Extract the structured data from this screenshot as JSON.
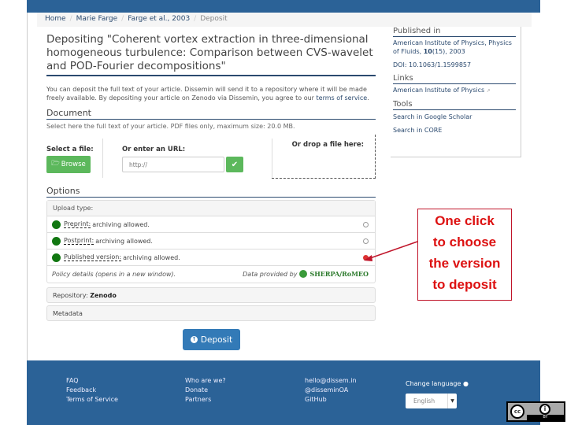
{
  "breadcrumb": {
    "items": [
      "Home",
      "Marie Farge",
      "Farge et al., 2003"
    ],
    "current": "Deposit"
  },
  "title": "Depositing \"Coherent vortex extraction in three-dimensional homogeneous turbulence: Comparison between CVS-wavelet and POD-Fourier decompositions\"",
  "intro": {
    "text": "You can deposit the full text of your article. Dissemin will send it to a repository where it will be made freely available. By depositing your article on Zenodo via Dissemin, you agree to our ",
    "link": "terms of service",
    "end": "."
  },
  "document": {
    "heading": "Document",
    "description": "Select here the full text of your article. PDF files only, maximum size: 20.0 MB.",
    "select_label": "Select a file:",
    "browse_label": "Browse",
    "url_label": "Or enter an URL:",
    "url_placeholder": "http://",
    "drop_label": "Or drop a file here:"
  },
  "options": {
    "heading": "Options",
    "upload_type_label": "Upload type:",
    "versions": [
      {
        "name": "Preprint:",
        "status": "archiving allowed.",
        "selected": false,
        "color": "#117711"
      },
      {
        "name": "Postprint:",
        "status": "archiving allowed.",
        "selected": false,
        "color": "#117711"
      },
      {
        "name": "Published version:",
        "status": "archiving allowed.",
        "selected": true,
        "color": "#117711"
      }
    ],
    "policy_link": "Policy details (opens in a new window).",
    "provided_by": "Data provided by",
    "provider": "SHERPA/RoMEO",
    "repository_label": "Repository:",
    "repository_value": "Zenodo",
    "metadata_label": "Metadata"
  },
  "deposit_button": "Deposit",
  "sidebar": {
    "published_heading": "Published in",
    "published_text": "American Institute of Physics, Physics of Fluids, ",
    "volume": "10",
    "issue_year": "(15), 2003",
    "doi": "DOI: 10.1063/1.1599857",
    "links_heading": "Links",
    "links": [
      "American Institute of Physics"
    ],
    "tools_heading": "Tools",
    "tools": [
      "Search in Google Scholar",
      "Search in CORE"
    ]
  },
  "footer": {
    "col1": [
      "FAQ",
      "Feedback",
      "Terms of Service"
    ],
    "col2": [
      "Who are we?",
      "Donate",
      "Partners"
    ],
    "col3": [
      "hello@dissem.in",
      "@disseminOA",
      "GitHub"
    ],
    "change_language": "Change language",
    "language": "English"
  },
  "license": {
    "cc": "cc",
    "by": "BY"
  },
  "annotation": {
    "text": [
      "One click",
      "to choose",
      "the version",
      "to deposit"
    ],
    "color": "#dd1111"
  },
  "colors": {
    "brand": "#2b6297",
    "success": "#5cb85c",
    "primary": "#337ab7"
  }
}
